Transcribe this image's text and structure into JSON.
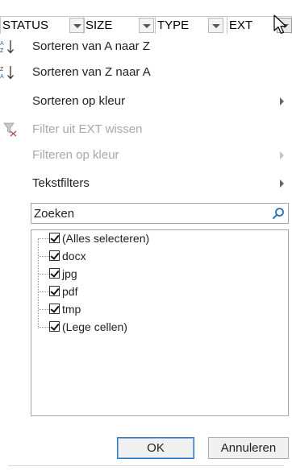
{
  "headers": [
    {
      "label": "STATUS"
    },
    {
      "label": "SIZE"
    },
    {
      "label": "TYPE"
    },
    {
      "label": "EXT"
    }
  ],
  "menu": {
    "sort_az": {
      "label": "Sorteren van A naar Z",
      "icon": "sort-ascending-icon"
    },
    "sort_za": {
      "label": "Sorteren van Z naar A",
      "icon": "sort-descending-icon"
    },
    "sort_color": {
      "label": "Sorteren op kleur"
    },
    "clear_filter": {
      "label": "Filter uit EXT wissen",
      "icon": "clear-filter-icon",
      "disabled": true
    },
    "filter_color": {
      "label": "Filteren op kleur",
      "disabled": true
    },
    "text_filters": {
      "label": "Tekstfilters"
    }
  },
  "search": {
    "placeholder": "Zoeken",
    "value": "",
    "icon": "search-icon"
  },
  "values": [
    {
      "label": "(Alles selecteren)",
      "checked": true
    },
    {
      "label": "docx",
      "checked": true
    },
    {
      "label": "jpg",
      "checked": true
    },
    {
      "label": "pdf",
      "checked": true
    },
    {
      "label": "tmp",
      "checked": true
    },
    {
      "label": "(Lege cellen)",
      "checked": true
    }
  ],
  "buttons": {
    "ok": "OK",
    "cancel": "Annuleren"
  },
  "colors": {
    "accent": "#2b78c5",
    "disabled_text": "#a8a8a8"
  }
}
